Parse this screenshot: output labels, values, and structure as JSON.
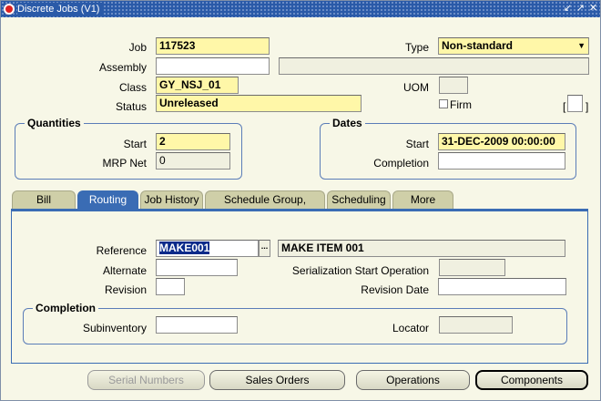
{
  "window": {
    "title": "Discrete Jobs (V1)"
  },
  "titlebar_buttons": [
    "↙",
    "↗",
    "✕"
  ],
  "header": {
    "job_label": "Job",
    "job_value": "117523",
    "type_label": "Type",
    "type_value": "Non-standard",
    "assembly_label": "Assembly",
    "assembly_value": "",
    "assembly_desc": "",
    "class_label": "Class",
    "class_value": "GY_NSJ_01",
    "uom_label": "UOM",
    "uom_value": "",
    "status_label": "Status",
    "status_value": "Unreleased",
    "firm_label": "Firm",
    "firm_checked": false,
    "dff_left": "[",
    "dff_right": "]"
  },
  "quantities": {
    "title": "Quantities",
    "start_label": "Start",
    "start_value": "2",
    "mrp_label": "MRP Net",
    "mrp_value": "0"
  },
  "dates": {
    "title": "Dates",
    "start_label": "Start",
    "start_value": "31-DEC-2009 00:00:00",
    "completion_label": "Completion",
    "completion_value": ""
  },
  "tabs": [
    {
      "label": "Bill",
      "active": false
    },
    {
      "label": "Routing",
      "active": true
    },
    {
      "label": "Job History",
      "active": false
    },
    {
      "label": "Schedule Group, Project",
      "active": false
    },
    {
      "label": "Scheduling",
      "active": false
    },
    {
      "label": "More",
      "active": false
    }
  ],
  "routing": {
    "reference_label": "Reference",
    "reference_value": "MAKE001",
    "reference_desc": "MAKE ITEM 001",
    "lov_button": "...",
    "alternate_label": "Alternate",
    "alternate_value": "",
    "serialization_label": "Serialization Start Operation",
    "serialization_value": "",
    "revision_label": "Revision",
    "revision_value": "",
    "revision_date_label": "Revision Date",
    "revision_date_value": "",
    "completion_title": "Completion",
    "subinventory_label": "Subinventory",
    "subinventory_value": "",
    "locator_label": "Locator",
    "locator_value": ""
  },
  "buttons": {
    "serial_numbers": "Serial Numbers",
    "sales_orders": "Sales Orders",
    "operations": "Operations",
    "components": "Components"
  },
  "colors": {
    "title_bar": "#2a5aa8",
    "canvas": "#F7F7E7",
    "required_field": "#FFF7A8",
    "active_tab": "#3a6cb4"
  }
}
